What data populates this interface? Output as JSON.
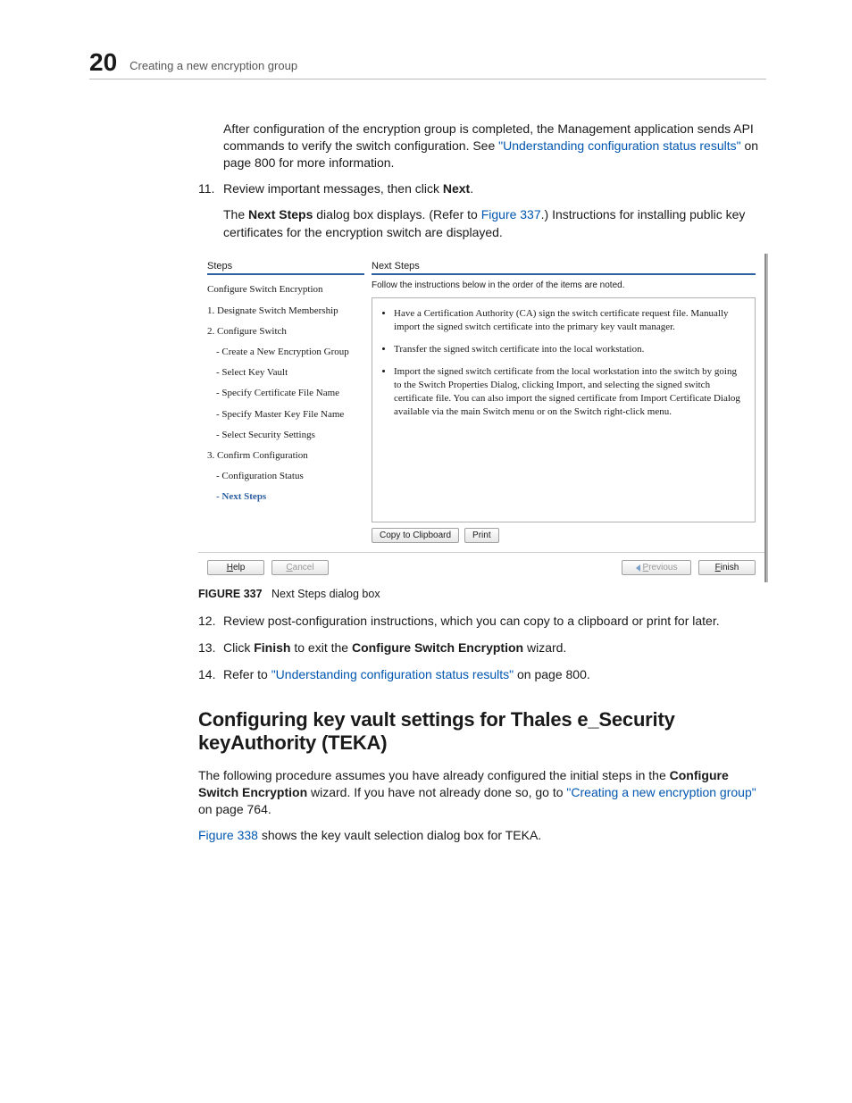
{
  "header": {
    "chapter_number": "20",
    "chapter_title": "Creating a new encryption group"
  },
  "intro_para": {
    "pre": "After configuration of the encryption group is completed, the Management application sends API commands to verify the switch configuration. See ",
    "link": "\"Understanding configuration status results\"",
    "post": " on page 800 for more information."
  },
  "steps": {
    "s11": {
      "num": "11.",
      "pre": "Review important messages, then click ",
      "bold": "Next",
      "post": ".",
      "sub_pre": "The ",
      "sub_bold": "Next Steps",
      "sub_mid": " dialog box displays. (Refer to ",
      "sub_link": "Figure 337",
      "sub_post": ".) Instructions for installing public key certificates for the encryption switch are displayed."
    },
    "s12": {
      "num": "12.",
      "text": "Review post-configuration instructions, which you can copy to a clipboard or print for later."
    },
    "s13": {
      "num": "13.",
      "pre": "Click ",
      "b1": "Finish",
      "mid": " to exit the ",
      "b2": "Configure Switch Encryption",
      "post": " wizard."
    },
    "s14": {
      "num": "14.",
      "pre": "Refer to ",
      "link": "\"Understanding configuration status results\"",
      "post": " on page 800."
    }
  },
  "dialog": {
    "steps_label": "Steps",
    "right_label": "Next Steps",
    "right_intro": "Follow the instructions below in the order of the items are noted.",
    "step_items": [
      "Configure Switch Encryption",
      "1. Designate Switch Membership",
      "2. Configure Switch",
      "- Create a New Encryption Group",
      "- Select Key Vault",
      "- Specify Certificate File Name",
      "- Specify Master Key File Name",
      "- Select Security Settings",
      "3. Confirm Configuration",
      "- Configuration Status",
      "- Next Steps"
    ],
    "instructions": [
      "Have a Certification Authority (CA) sign the switch certificate request file. Manually import the signed switch certificate into the primary key vault manager.",
      "Transfer the signed switch certificate into the local workstation.",
      "Import the signed switch certificate from the local workstation into the switch by going to the Switch Properties Dialog, clicking Import, and selecting the signed switch certificate file. You can also import the signed certificate from Import Certificate Dialog available via the main Switch menu or on the Switch right-click menu."
    ],
    "btn_copy": "Copy to Clipboard",
    "btn_print": "Print",
    "btn_help": "Help",
    "btn_cancel": "Cancel",
    "btn_prev": "Previous",
    "btn_finish": "Finish"
  },
  "figure": {
    "label": "FIGURE 337",
    "caption": "Next Steps dialog box"
  },
  "section_title": "Configuring key vault settings for Thales e_Security keyAuthority (TEKA)",
  "section_para": {
    "pre": "The following procedure assumes you have already configured the initial steps in the ",
    "b1": "Configure Switch Encryption",
    "mid": " wizard. If you have not already done so, go to ",
    "link": "\"Creating a new encryption group\"",
    "post": " on page 764."
  },
  "section_para2": {
    "link": "Figure 338",
    "post": " shows the key vault selection dialog box for TEKA."
  }
}
